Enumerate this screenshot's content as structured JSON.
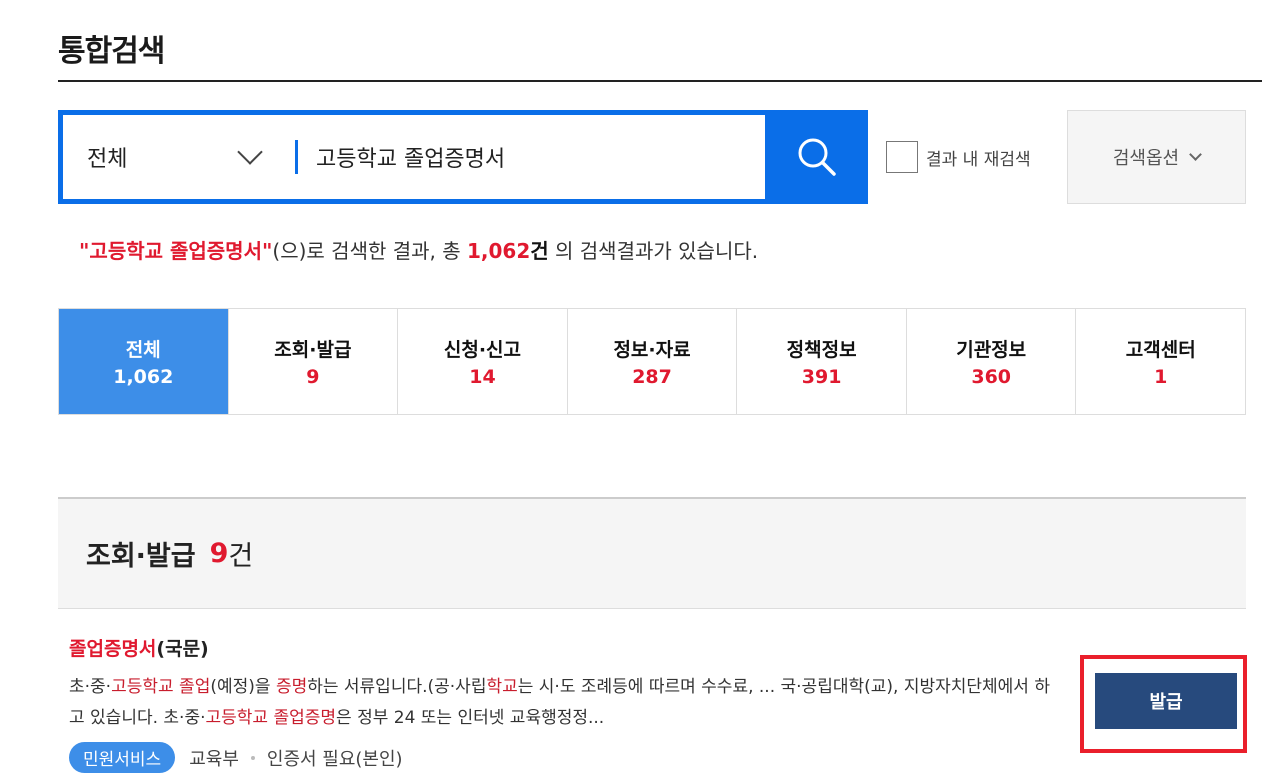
{
  "page": {
    "title": "통합검색"
  },
  "search": {
    "scope": "전체",
    "query": "고등학교 졸업증명서",
    "research_label": "결과 내 재검색",
    "options_label": "검색옵션"
  },
  "summary": {
    "query_quoted": "\"고등학교 졸업증명서\"",
    "text_before_count": "(으)로 검색한 결과, 총 ",
    "count": "1,062",
    "count_unit": "건",
    "text_after": " 의 검색결과가 있습니다."
  },
  "tabs": [
    {
      "label": "전체",
      "count": "1,062"
    },
    {
      "label": "조회·발급",
      "count": "9"
    },
    {
      "label": "신청·신고",
      "count": "14"
    },
    {
      "label": "정보·자료",
      "count": "287"
    },
    {
      "label": "정책정보",
      "count": "391"
    },
    {
      "label": "기관정보",
      "count": "360"
    },
    {
      "label": "고객센터",
      "count": "1"
    }
  ],
  "section": {
    "title": "조회·발급",
    "count": "9",
    "unit": "건"
  },
  "item": {
    "title_highlight": "졸업증명서",
    "title_rest": "(국문)",
    "desc": {
      "p1": "초·중·",
      "h1": "고등학교 졸업",
      "p2": "(예정)을 ",
      "h2": "증명",
      "p3": "하는 서류입니다.(공·사립",
      "h3": "학교",
      "p4": "는 시·도 조례등에 따르며 수수료, ... 국·공립대학(교), 지방자치단체에서 하고 있습니다. 초·중·",
      "h4": "고등학교 졸업증명",
      "p5": "은 정부 24 또는 인터넷 교육행정정..."
    },
    "badge": "민원서비스",
    "org": "교육부",
    "requirement": "인증서 필요(본인)",
    "action_label": "발급"
  },
  "colors": {
    "primary_blue": "#0a6ee8",
    "active_tab": "#3d8ee8",
    "highlight_red": "#e0192f",
    "issue_button": "#274a7d",
    "frame_red": "#ea1f2b"
  }
}
